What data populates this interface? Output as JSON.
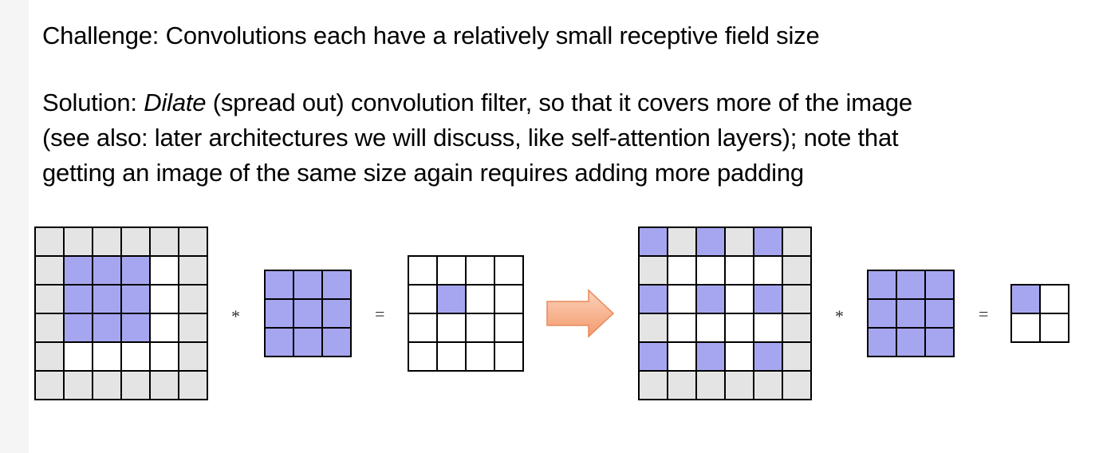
{
  "challenge_text": "Challenge: Convolutions each have a relatively small receptive field size",
  "solution": {
    "lead": "Solution: ",
    "emph": "Dilate",
    "line1_rest": " (spread out) convolution filter, so that it covers more of the image",
    "line2": "(see also: later architectures we will discuss, like self-attention layers); note that",
    "line3": "getting an image of the same size again requires adding more padding"
  },
  "operators": {
    "multiply": "*",
    "equals": "="
  },
  "colors": {
    "highlight": "#a6a6f0",
    "padding": "#e4e4e4",
    "arrow_fill": "#f7b490",
    "arrow_stroke": "#e8895a"
  },
  "grids": {
    "standard_input": {
      "rows": [
        "PPPPPP",
        "PHHHWP",
        "PHHHWP",
        "PHHHWP",
        "PWWWWP",
        "PPPPPP"
      ]
    },
    "standard_kernel": {
      "rows": [
        "HHH",
        "HHH",
        "HHH"
      ]
    },
    "standard_output": {
      "rows": [
        "WWWW",
        "WHWW",
        "WWWW",
        "WWWW"
      ]
    },
    "dilated_input": {
      "rows": [
        "HPHPHP",
        "PWWWWP",
        "HWHWHP",
        "PWWWWP",
        "HWHWHP",
        "PPPPPP"
      ]
    },
    "dilated_kernel": {
      "rows": [
        "HHH",
        "HHH",
        "HHH"
      ]
    },
    "dilated_output": {
      "rows": [
        "HW",
        "WW"
      ]
    }
  }
}
